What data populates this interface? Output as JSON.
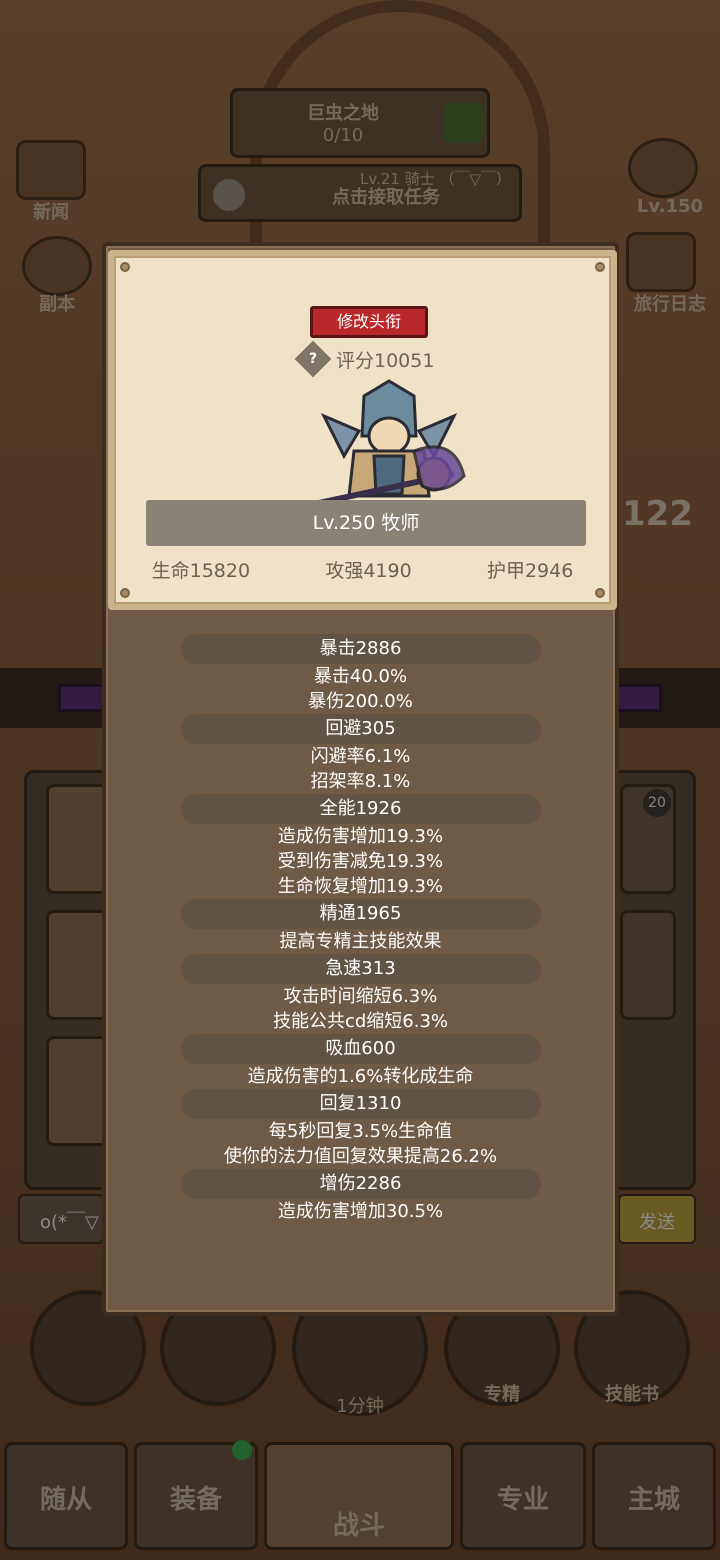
{
  "background": {
    "location_name": "巨虫之地",
    "location_progress": "0/10",
    "task_button": "点击接取任务",
    "player_info": "Lv.21 骑士 （￣▽￣）",
    "left_icons": [
      "新闻",
      "副本"
    ],
    "right_icons": [
      "Lv.150",
      "旅行日志"
    ],
    "counter": "122",
    "slot_badge": "20",
    "chat_input": "o(*￣▽",
    "send_button": "发送",
    "action_buttons": [
      "1分钟",
      "专精",
      "技能书"
    ],
    "bottom_tabs": [
      "随从",
      "装备",
      "战斗",
      "专业",
      "主城"
    ]
  },
  "card": {
    "edit_title_button": "修改头衔",
    "score": "评分10051",
    "level_class": "Lv.250 牧师",
    "stats": [
      "生命15820",
      "攻强4190",
      "护甲2946"
    ]
  },
  "attribute_groups": [
    {
      "header": "暴击2886",
      "lines": [
        "暴击40.0%",
        "暴伤200.0%"
      ]
    },
    {
      "header": "回避305",
      "lines": [
        "闪避率6.1%",
        "招架率8.1%"
      ]
    },
    {
      "header": "全能1926",
      "lines": [
        "造成伤害增加19.3%",
        "受到伤害减免19.3%",
        "生命恢复增加19.3%"
      ]
    },
    {
      "header": "精通1965",
      "lines": [
        "提高专精主技能效果"
      ]
    },
    {
      "header": "急速313",
      "lines": [
        "攻击时间缩短6.3%",
        "技能公共cd缩短6.3%"
      ]
    },
    {
      "header": "吸血600",
      "lines": [
        "造成伤害的1.6%转化成生命"
      ]
    },
    {
      "header": "回复1310",
      "lines": [
        "每5秒回复3.5%生命值",
        "使你的法力值回复效果提高26.2%"
      ]
    },
    {
      "header": "增伤2286",
      "lines": [
        "造成伤害增加30.5%"
      ]
    }
  ]
}
